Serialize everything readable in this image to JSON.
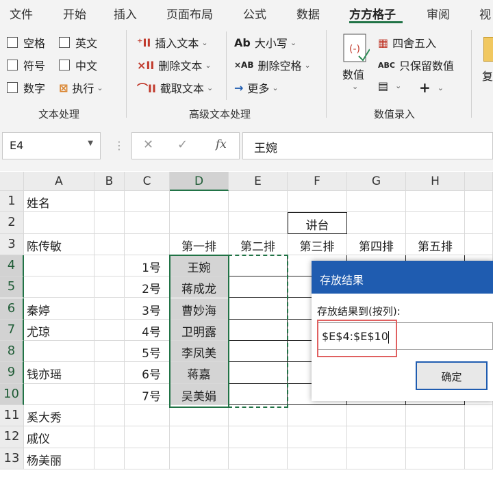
{
  "menu": {
    "items": [
      "文件",
      "开始",
      "插入",
      "页面布局",
      "公式",
      "数据",
      "方方格子",
      "审阅",
      "视"
    ],
    "active": "方方格子"
  },
  "ribbon": {
    "text_group": {
      "checkboxes": [
        "空格",
        "英文",
        "符号",
        "中文",
        "数字"
      ],
      "execute": "执行",
      "label": "文本处理"
    },
    "advanced_group": {
      "insert_text": "插入文本",
      "delete_text": "删除文本",
      "extract_text": "截取文本",
      "case": "大小写",
      "delete_space": "删除空格",
      "more": "更多",
      "label": "高级文本处理"
    },
    "number_group": {
      "value_btn": "数值",
      "round": "四舍五入",
      "keep_values": "只保留数值",
      "label": "数值录入"
    },
    "right_cut": "复"
  },
  "formula_bar": {
    "name_box": "E4",
    "value": "王婉"
  },
  "sheet": {
    "columns": [
      "A",
      "B",
      "C",
      "D",
      "E",
      "F",
      "G",
      "H"
    ],
    "rows": [
      "1",
      "2",
      "3",
      "4",
      "5",
      "6",
      "7",
      "8",
      "9",
      "10",
      "11",
      "12",
      "13"
    ],
    "colA": [
      "姓名",
      "",
      "陈传敏",
      "",
      "",
      "秦婷",
      "尤琼",
      "",
      "钱亦瑶",
      "",
      "奚大秀",
      "戚仪",
      "杨美丽"
    ],
    "colC": [
      "",
      "",
      "",
      "1号",
      "2号",
      "3号",
      "4号",
      "5号",
      "6号",
      "7号",
      "",
      "",
      ""
    ],
    "row3_headers": [
      "第一排",
      "第二排",
      "第三排",
      "第四排",
      "第五排"
    ],
    "podium": "讲台",
    "colD": [
      "王婉",
      "蒋成龙",
      "曹妙海",
      "卫明露",
      "李凤美",
      "蒋嘉",
      "吴美娟"
    ]
  },
  "dialog": {
    "title": "存放结果",
    "label": "存放结果到(按列):",
    "input_value": "$E$4:$E$10",
    "ok": "确定"
  }
}
